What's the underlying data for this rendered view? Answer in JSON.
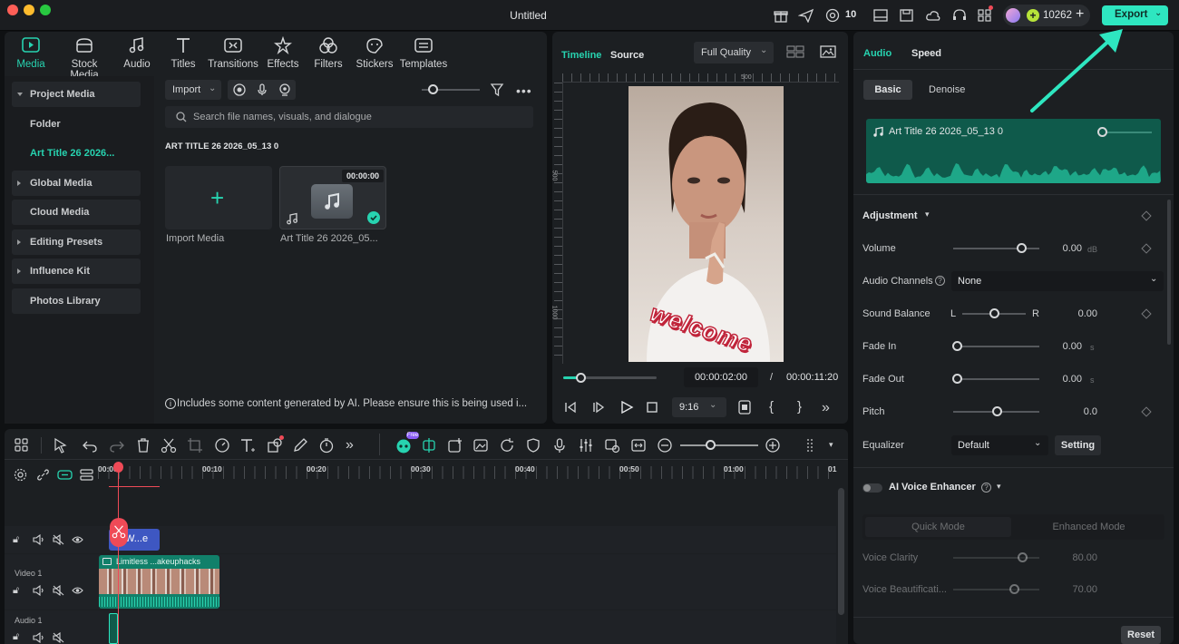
{
  "window": {
    "title": "Untitled",
    "notif_count": "10",
    "credits": "10262",
    "export_label": "Export"
  },
  "toolbar_tabs": [
    {
      "label": "Media",
      "icon": "media-icon"
    },
    {
      "label": "Stock Media",
      "icon": "stock-media-icon"
    },
    {
      "label": "Audio",
      "icon": "audio-note-icon"
    },
    {
      "label": "Titles",
      "icon": "titles-icon"
    },
    {
      "label": "Transitions",
      "icon": "transitions-icon"
    },
    {
      "label": "Effects",
      "icon": "effects-icon"
    },
    {
      "label": "Filters",
      "icon": "filters-icon"
    },
    {
      "label": "Stickers",
      "icon": "stickers-icon"
    },
    {
      "label": "Templates",
      "icon": "templates-icon"
    }
  ],
  "sidebar": {
    "project_media": "Project Media",
    "folder": "Folder",
    "art_title": "Art Title 26 2026...",
    "global_media": "Global Media",
    "cloud_media": "Cloud Media",
    "editing_presets": "Editing Presets",
    "influence_kit": "Influence Kit",
    "photos_library": "Photos Library"
  },
  "media": {
    "import_label": "Import",
    "search_placeholder": "Search file names, visuals, and dialogue",
    "folder_title": "ART TITLE 26 2026_05_13 0",
    "import_media_label": "Import Media",
    "clip_duration": "00:00:00",
    "clip_name": "Art Title 26 2026_05...",
    "ai_notice": "Includes some content generated by AI. Please ensure this is being used i..."
  },
  "player": {
    "tab_timeline": "Timeline",
    "tab_source": "Source",
    "quality": "Full Quality",
    "ruler_500": "500",
    "ruler_1000": "1000",
    "sticker_text": "welcome",
    "current_time": "00:00:02:00",
    "separator": "/",
    "total_time": "00:00:11:20",
    "aspect": "9:16",
    "progress": 0.18
  },
  "inspector": {
    "tab_audio": "Audio",
    "tab_speed": "Speed",
    "sub_basic": "Basic",
    "sub_denoise": "Denoise",
    "clip_title": "Art Title 26 2026_05_13 0",
    "adjustment": "Adjustment",
    "volume_label": "Volume",
    "volume_value": "0.00",
    "volume_unit": "dB",
    "volume_level": 0.5,
    "channels_label": "Audio Channels",
    "channels_value": "None",
    "balance_label": "Sound Balance",
    "balance_l": "L",
    "balance_r": "R",
    "balance_value": "0.00",
    "balance_level": 0.5,
    "fade_in_label": "Fade In",
    "fade_in_value": "0.00",
    "fade_in_unit": "s",
    "fade_out_label": "Fade Out",
    "fade_out_value": "0.00",
    "fade_out_unit": "s",
    "pitch_label": "Pitch",
    "pitch_value": "0.0",
    "pitch_level": 0.5,
    "equalizer_label": "Equalizer",
    "equalizer_value": "Default",
    "setting_label": "Setting",
    "ai_voice_label": "AI Voice Enhancer",
    "quick_mode": "Quick Mode",
    "enhanced_mode": "Enhanced Mode",
    "clarity_label": "Voice Clarity",
    "clarity_value": "80.00",
    "clarity_level": 0.8,
    "beautification_label": "Voice Beautificati...",
    "beautification_value": "70.00",
    "beautification_level": 0.7,
    "reset_label": "Reset"
  },
  "timeline": {
    "ticks": [
      "00:00",
      "00:10",
      "00:20",
      "00:30",
      "00:40",
      "00:50",
      "01:00",
      "01"
    ],
    "title_clip": "W...e",
    "video_track": "Video 1",
    "video_clip": "Limitless ...akeuphacks",
    "audio_track": "Audio 1",
    "ai_badge": "Free"
  },
  "colors": {
    "accent": "#27d3b0",
    "export_bg": "#2ee6c0",
    "playhead": "#ef4a57",
    "title_clip": "#3e57c2",
    "video_clip": "#11806a"
  }
}
